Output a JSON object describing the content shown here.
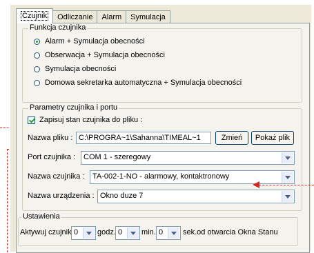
{
  "tabs": [
    {
      "label": "Czujnik",
      "active": true
    },
    {
      "label": "Odliczanie",
      "active": false
    },
    {
      "label": "Alarm",
      "active": false
    },
    {
      "label": "Symulacja",
      "active": false
    }
  ],
  "sensor_function": {
    "title": "Funkcja czujnika",
    "options": [
      {
        "label": "Alarm + Symulacja obecności",
        "selected": true
      },
      {
        "label": "Obserwacja + Symulacja obecności",
        "selected": false
      },
      {
        "label": "Symulacja obecności",
        "selected": false
      },
      {
        "label": "Domowa sekretarka automatyczna + Symulacja obecności",
        "selected": false
      }
    ]
  },
  "params": {
    "title": "Parametry czujnika i portu",
    "save_state_label": "Zapisuj stan czujnika do pliku :",
    "save_state_checked": true,
    "file_name_label": "Nazwa pliku :",
    "file_name_value": "C:\\PROGRA~1\\Sahanna\\TIMEAL~1",
    "change_button": "Zmień",
    "show_file_button": "Pokaż plik",
    "port_label": "Port czujnika :",
    "port_value": "COM 1 - szeregowy",
    "sensor_name_label": "Nazwa czujnika :",
    "sensor_name_value": "TA-002-1-NO - alarmowy, kontaktronowy",
    "device_name_label": "Nazwa urządzenia :",
    "device_name_value": "Okno duze 7"
  },
  "settings": {
    "title": "Ustawienia",
    "activate_label": "Aktywuj czujnik",
    "hours_value": "0",
    "hours_label": "godz.",
    "minutes_value": "0",
    "minutes_label": "min.",
    "seconds_value": "0",
    "seconds_label": "sek.od otwarcia Okna Stanu"
  },
  "colors": {
    "annotation_arrow": "#e2231a",
    "check_mark": "#21a121"
  }
}
